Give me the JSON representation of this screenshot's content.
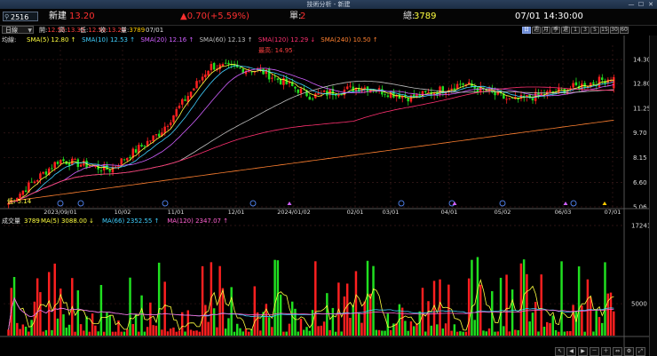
{
  "window": {
    "title": "技術分析 - 新建",
    "minimize": "—",
    "maximize": "☐",
    "close": "✕"
  },
  "quote": {
    "code": "2516",
    "name": "新建",
    "price": "13.20",
    "change": "▲0.70(+5.59%)",
    "single_label": "單:",
    "single_value": "2",
    "total_label": "總:",
    "total_value": "3789",
    "datetime": "07/01 14:30:00"
  },
  "toolbar": {
    "period_select": "日線",
    "ohlc": [
      {
        "label": "開:",
        "value": "12.50",
        "color": "#ff4040"
      },
      {
        "label": "高:",
        "value": "13.35",
        "color": "#ff4040"
      },
      {
        "label": "低:",
        "value": "12.50",
        "color": "#ff4040"
      },
      {
        "label": "收:",
        "value": "13.20",
        "color": "#ff4040"
      },
      {
        "label": "量:",
        "value": "3789",
        "color": "#ffcc00"
      },
      {
        "label": "",
        "value": "07/01",
        "color": "#dddddd"
      }
    ],
    "period_buttons": [
      "日",
      "週",
      "月",
      "季",
      "還",
      "1",
      "3",
      "5",
      "15",
      "30",
      "60"
    ],
    "active_period": "日"
  },
  "price_pane": {
    "legend_label": "均線",
    "ma_legend": [
      {
        "text": "SMA(5) 12.80 ↑",
        "color": "#ffff40"
      },
      {
        "text": "SMA(10) 12.53 ↑",
        "color": "#40d0ff"
      },
      {
        "text": "SMA(20) 12.16 ↑",
        "color": "#d060ff"
      },
      {
        "text": "SMA(60) 12.13 ↑",
        "color": "#c0c0c0"
      },
      {
        "text": "SMA(120) 12.29 ↓",
        "color": "#ff3070"
      },
      {
        "text": "SMA(240) 10.50 ↑",
        "color": "#ff8030"
      }
    ],
    "y_ticks": [
      "14.30",
      "12.80",
      "11.25",
      "9.70",
      "8.15",
      "6.60",
      "5.06"
    ],
    "high_label": "最高: 14.95",
    "low_label": "低: 5.14",
    "x_ticks": [
      "2023/09/01",
      "10/02",
      "11/01",
      "12/01",
      "2024/01/02",
      "02/01",
      "03/01",
      "04/01",
      "05/02",
      "06/03",
      "07/01"
    ]
  },
  "volume_pane": {
    "legend_label": "成交量",
    "volume_value": "3789",
    "legend": [
      {
        "text": "MA(5) 3088.00 ↓",
        "color": "#ffff40"
      },
      {
        "text": "MA(66) 2352.55 ↑",
        "color": "#40d0ff"
      },
      {
        "text": "MA(120) 2347.07 ↑",
        "color": "#ff60d0"
      }
    ],
    "y_ticks": [
      "17241",
      "5000"
    ]
  },
  "colors": {
    "up": "#ff2020",
    "down": "#20e020",
    "grid": "#3a1a1a",
    "axis": "#888888"
  },
  "chart_data": {
    "type": "candlestick",
    "price_range": [
      5.06,
      15.2
    ],
    "volume_max": 17241,
    "monthly_close_path": [
      5.3,
      8.0,
      7.4,
      9.7,
      13.9,
      13.6,
      12.0,
      12.6,
      11.9,
      12.8,
      11.7,
      12.4,
      13.2
    ],
    "last": {
      "open": 12.5,
      "high": 13.35,
      "low": 12.5,
      "close": 13.2,
      "volume": 3789
    }
  }
}
